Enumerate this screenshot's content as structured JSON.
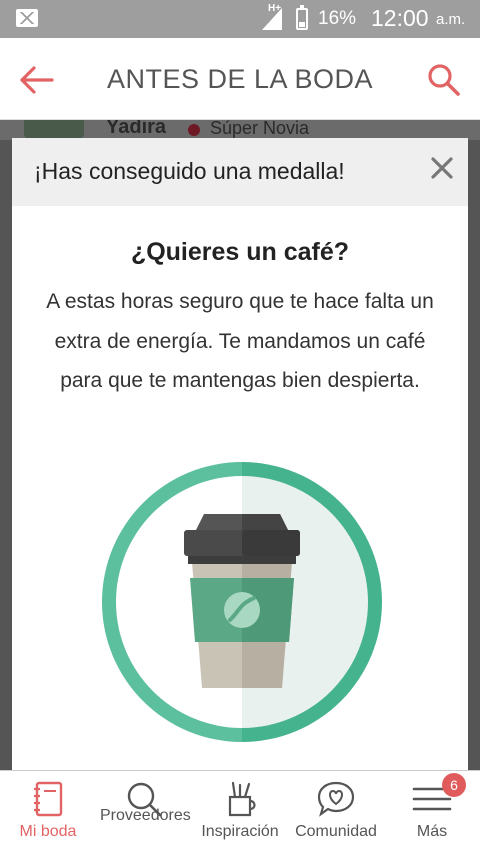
{
  "status_bar": {
    "network": "H+",
    "battery": "16%",
    "time": "12:00",
    "ampm": "a.m."
  },
  "app_bar": {
    "title": "ANTES DE LA BODA"
  },
  "underlying": {
    "user_name": "Yadira",
    "user_badge": "Súper Novia"
  },
  "modal": {
    "title": "¡Has conseguido una medalla!",
    "heading": "¿Quieres un café?",
    "body": "A estas horas seguro que te hace falta un extra de energía. Te mandamos un café para que te mantengas bien despierta."
  },
  "bottom_nav": {
    "items": [
      {
        "label": "Mi boda",
        "icon": "notebook-icon",
        "active": true
      },
      {
        "label": "Proveedores",
        "icon": "search-icon",
        "active": false
      },
      {
        "label": "Inspiración",
        "icon": "pencil-cup-icon",
        "active": false
      },
      {
        "label": "Comunidad",
        "icon": "chat-heart-icon",
        "active": false
      },
      {
        "label": "Más",
        "icon": "menu-icon",
        "active": false,
        "count": "6"
      }
    ]
  },
  "colors": {
    "accent": "#e26363",
    "medal_green": "#5cbf9d",
    "cup_green": "#4e9a78"
  }
}
